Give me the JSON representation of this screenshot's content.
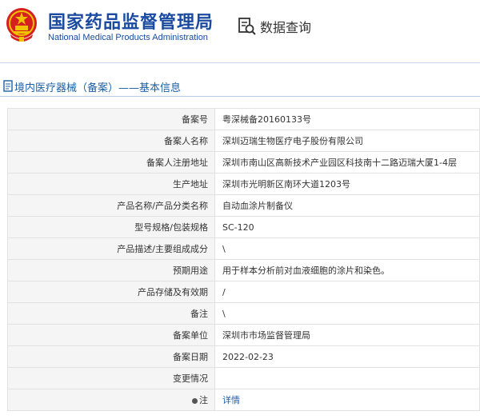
{
  "header": {
    "title_cn": "国家药品监督管理局",
    "title_en": "National Medical Products Administration",
    "query_label": "数据查询"
  },
  "breadcrumb": {
    "text": "境内医疗器械（备案）——基本信息"
  },
  "rows": [
    {
      "label": "备案号",
      "value": "粤深械备20160133号"
    },
    {
      "label": "备案人名称",
      "value": "深圳迈瑞生物医疗电子股份有限公司"
    },
    {
      "label": "备案人注册地址",
      "value": "深圳市南山区高新技术产业园区科技南十二路迈瑞大厦1-4层"
    },
    {
      "label": "生产地址",
      "value": "深圳市光明新区南环大道1203号"
    },
    {
      "label": "产品名称/产品分类名称",
      "value": "自动血涂片制备仪"
    },
    {
      "label": "型号规格/包装规格",
      "value": "SC-120"
    },
    {
      "label": "产品描述/主要组成成分",
      "value": "\\"
    },
    {
      "label": "预期用途",
      "value": "用于样本分析前对血液细胞的涂片和染色。"
    },
    {
      "label": "产品存储及有效期",
      "value": "/"
    },
    {
      "label": "备注",
      "value": "\\"
    },
    {
      "label": "备案单位",
      "value": "深圳市市场监督管理局"
    },
    {
      "label": "备案日期",
      "value": "2022-02-23"
    },
    {
      "label": "变更情况",
      "value": ""
    },
    {
      "label": "注",
      "value": "详情"
    }
  ],
  "colors": {
    "brand_blue": "#1a4ba0",
    "link_blue": "#1a5fa6",
    "emblem_red": "#d6201f",
    "emblem_gold": "#f2c200"
  },
  "icons": {
    "emblem": "national-emblem-icon",
    "query": "search-document-icon",
    "breadcrumb": "document-icon",
    "note": "note-bulb-icon"
  }
}
